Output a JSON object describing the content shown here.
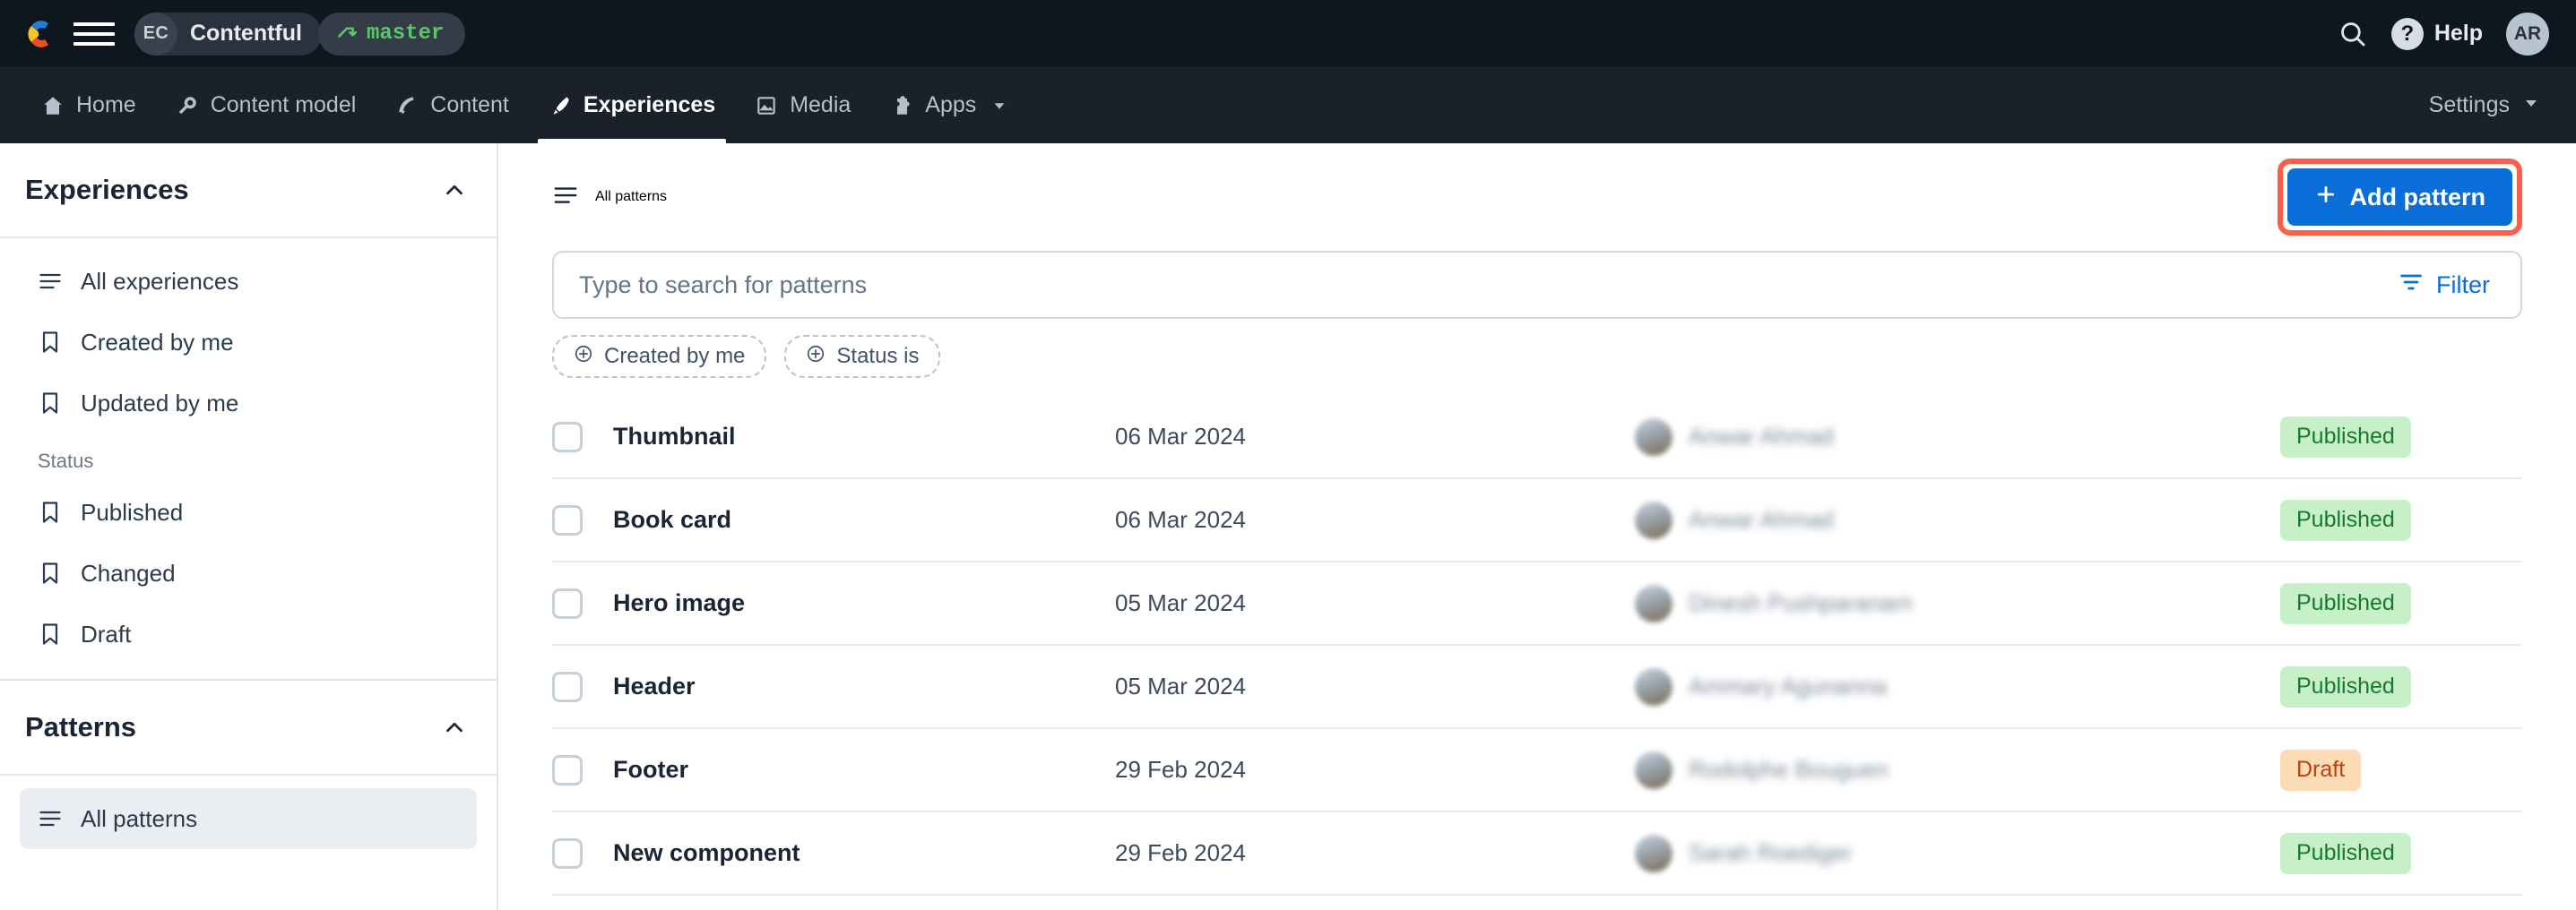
{
  "topbar": {
    "logo_icon": "contentful-logo-icon",
    "menu_icon": "hamburger-menu-icon",
    "org_initials": "EC",
    "space_name": "Contentful",
    "env_icon": "branch-icon",
    "env_name": "master",
    "search_icon": "search-icon",
    "help_icon": "question-mark-icon",
    "help_label": "Help",
    "user_initials": "AR"
  },
  "nav": {
    "items": [
      {
        "label": "Home",
        "icon": "home-icon",
        "active": false
      },
      {
        "label": "Content model",
        "icon": "wrench-icon",
        "active": false
      },
      {
        "label": "Content",
        "icon": "pen-nib-icon",
        "active": false
      },
      {
        "label": "Experiences",
        "icon": "paintbrush-icon",
        "active": true
      },
      {
        "label": "Media",
        "icon": "image-icon",
        "active": false
      },
      {
        "label": "Apps",
        "icon": "puzzle-icon",
        "active": false
      }
    ],
    "settings_label": "Settings",
    "settings_caret_icon": "caret-down-icon"
  },
  "sidebar": {
    "experiences": {
      "title": "Experiences",
      "collapse_icon": "chevron-up-icon",
      "items": [
        {
          "label": "All experiences",
          "icon": "list-icon",
          "selected": false
        },
        {
          "label": "Created by me",
          "icon": "bookmark-icon",
          "selected": false
        },
        {
          "label": "Updated by me",
          "icon": "bookmark-icon",
          "selected": false
        }
      ],
      "group_label": "Status",
      "status_items": [
        {
          "label": "Published",
          "icon": "bookmark-icon",
          "selected": false
        },
        {
          "label": "Changed",
          "icon": "bookmark-icon",
          "selected": false
        },
        {
          "label": "Draft",
          "icon": "bookmark-icon",
          "selected": false
        }
      ]
    },
    "patterns": {
      "title": "Patterns",
      "collapse_icon": "chevron-up-icon",
      "items": [
        {
          "label": "All patterns",
          "icon": "list-icon",
          "selected": true
        }
      ]
    }
  },
  "main": {
    "title": "All patterns",
    "title_icon": "list-icon",
    "add_button": {
      "label": "Add pattern",
      "icon": "plus-icon",
      "highlight_color": "#fb5f4a",
      "bg_color": "#0b6ed8"
    },
    "search": {
      "placeholder": "Type to search for patterns",
      "value": ""
    },
    "filter_button": {
      "label": "Filter",
      "icon": "filter-icon",
      "color": "#0b6ed8"
    },
    "chips": [
      {
        "label": "Created by me",
        "icon": "plus-circle-icon"
      },
      {
        "label": "Status is",
        "icon": "plus-circle-icon"
      }
    ],
    "table": {
      "row_menu_icon": "ellipsis-icon",
      "checkbox_icon": "checkbox-unchecked-icon",
      "rows": [
        {
          "name": "Thumbnail",
          "date": "06 Mar 2024",
          "author": "Anwar Ahmad",
          "status": "Published",
          "status_type": "published",
          "checked": false
        },
        {
          "name": "Book card",
          "date": "06 Mar 2024",
          "author": "Anwar Ahmad",
          "status": "Published",
          "status_type": "published",
          "checked": false
        },
        {
          "name": "Hero image",
          "date": "05 Mar 2024",
          "author": "Dinesh Pushparanam",
          "status": "Published",
          "status_type": "published",
          "checked": false
        },
        {
          "name": "Header",
          "date": "05 Mar 2024",
          "author": "Ammary Agunanna",
          "status": "Published",
          "status_type": "published",
          "checked": false
        },
        {
          "name": "Footer",
          "date": "29 Feb 2024",
          "author": "Rodolphe Bouguen",
          "status": "Draft",
          "status_type": "draft",
          "checked": false
        },
        {
          "name": "New component",
          "date": "29 Feb 2024",
          "author": "Sarah Roediger",
          "status": "Published",
          "status_type": "published",
          "checked": false
        }
      ]
    }
  }
}
